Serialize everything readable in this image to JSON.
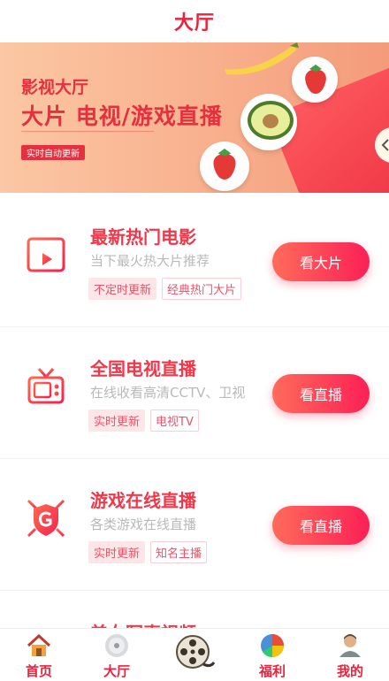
{
  "header": {
    "title": "大厅"
  },
  "banner": {
    "line1": "影视大厅",
    "line2": "大片 电视/游戏直播",
    "badge": "实时自动更新"
  },
  "cards": [
    {
      "title": "最新热门电影",
      "desc": "当下最火热大片推荐",
      "tags": [
        "不定时更新",
        "经典热门大片"
      ],
      "button": "看大片",
      "icon": "film-clapper-icon"
    },
    {
      "title": "全国电视直播",
      "desc": "在线收看高清CCTV、卫视",
      "tags": [
        "实时更新",
        "电视TV"
      ],
      "button": "看直播",
      "icon": "tv-icon"
    },
    {
      "title": "游戏在线直播",
      "desc": "各类游戏在线直播",
      "tags": [
        "实时更新",
        "知名主播"
      ],
      "button": "看直播",
      "icon": "game-shield-icon"
    }
  ],
  "partial_card": {
    "title": "美女写真视频"
  },
  "tabbar": [
    {
      "label": "首页",
      "icon": "home-icon"
    },
    {
      "label": "大厅",
      "icon": "disc-icon"
    },
    {
      "label": "",
      "icon": "film-reel-icon"
    },
    {
      "label": "福利",
      "icon": "pie-chart-icon"
    },
    {
      "label": "我的",
      "icon": "user-avatar-icon"
    }
  ],
  "colors": {
    "accent": "#e8233d",
    "button_from": "#ff6b5b",
    "button_to": "#fb2056",
    "tag_bg": "#fde6e8"
  }
}
